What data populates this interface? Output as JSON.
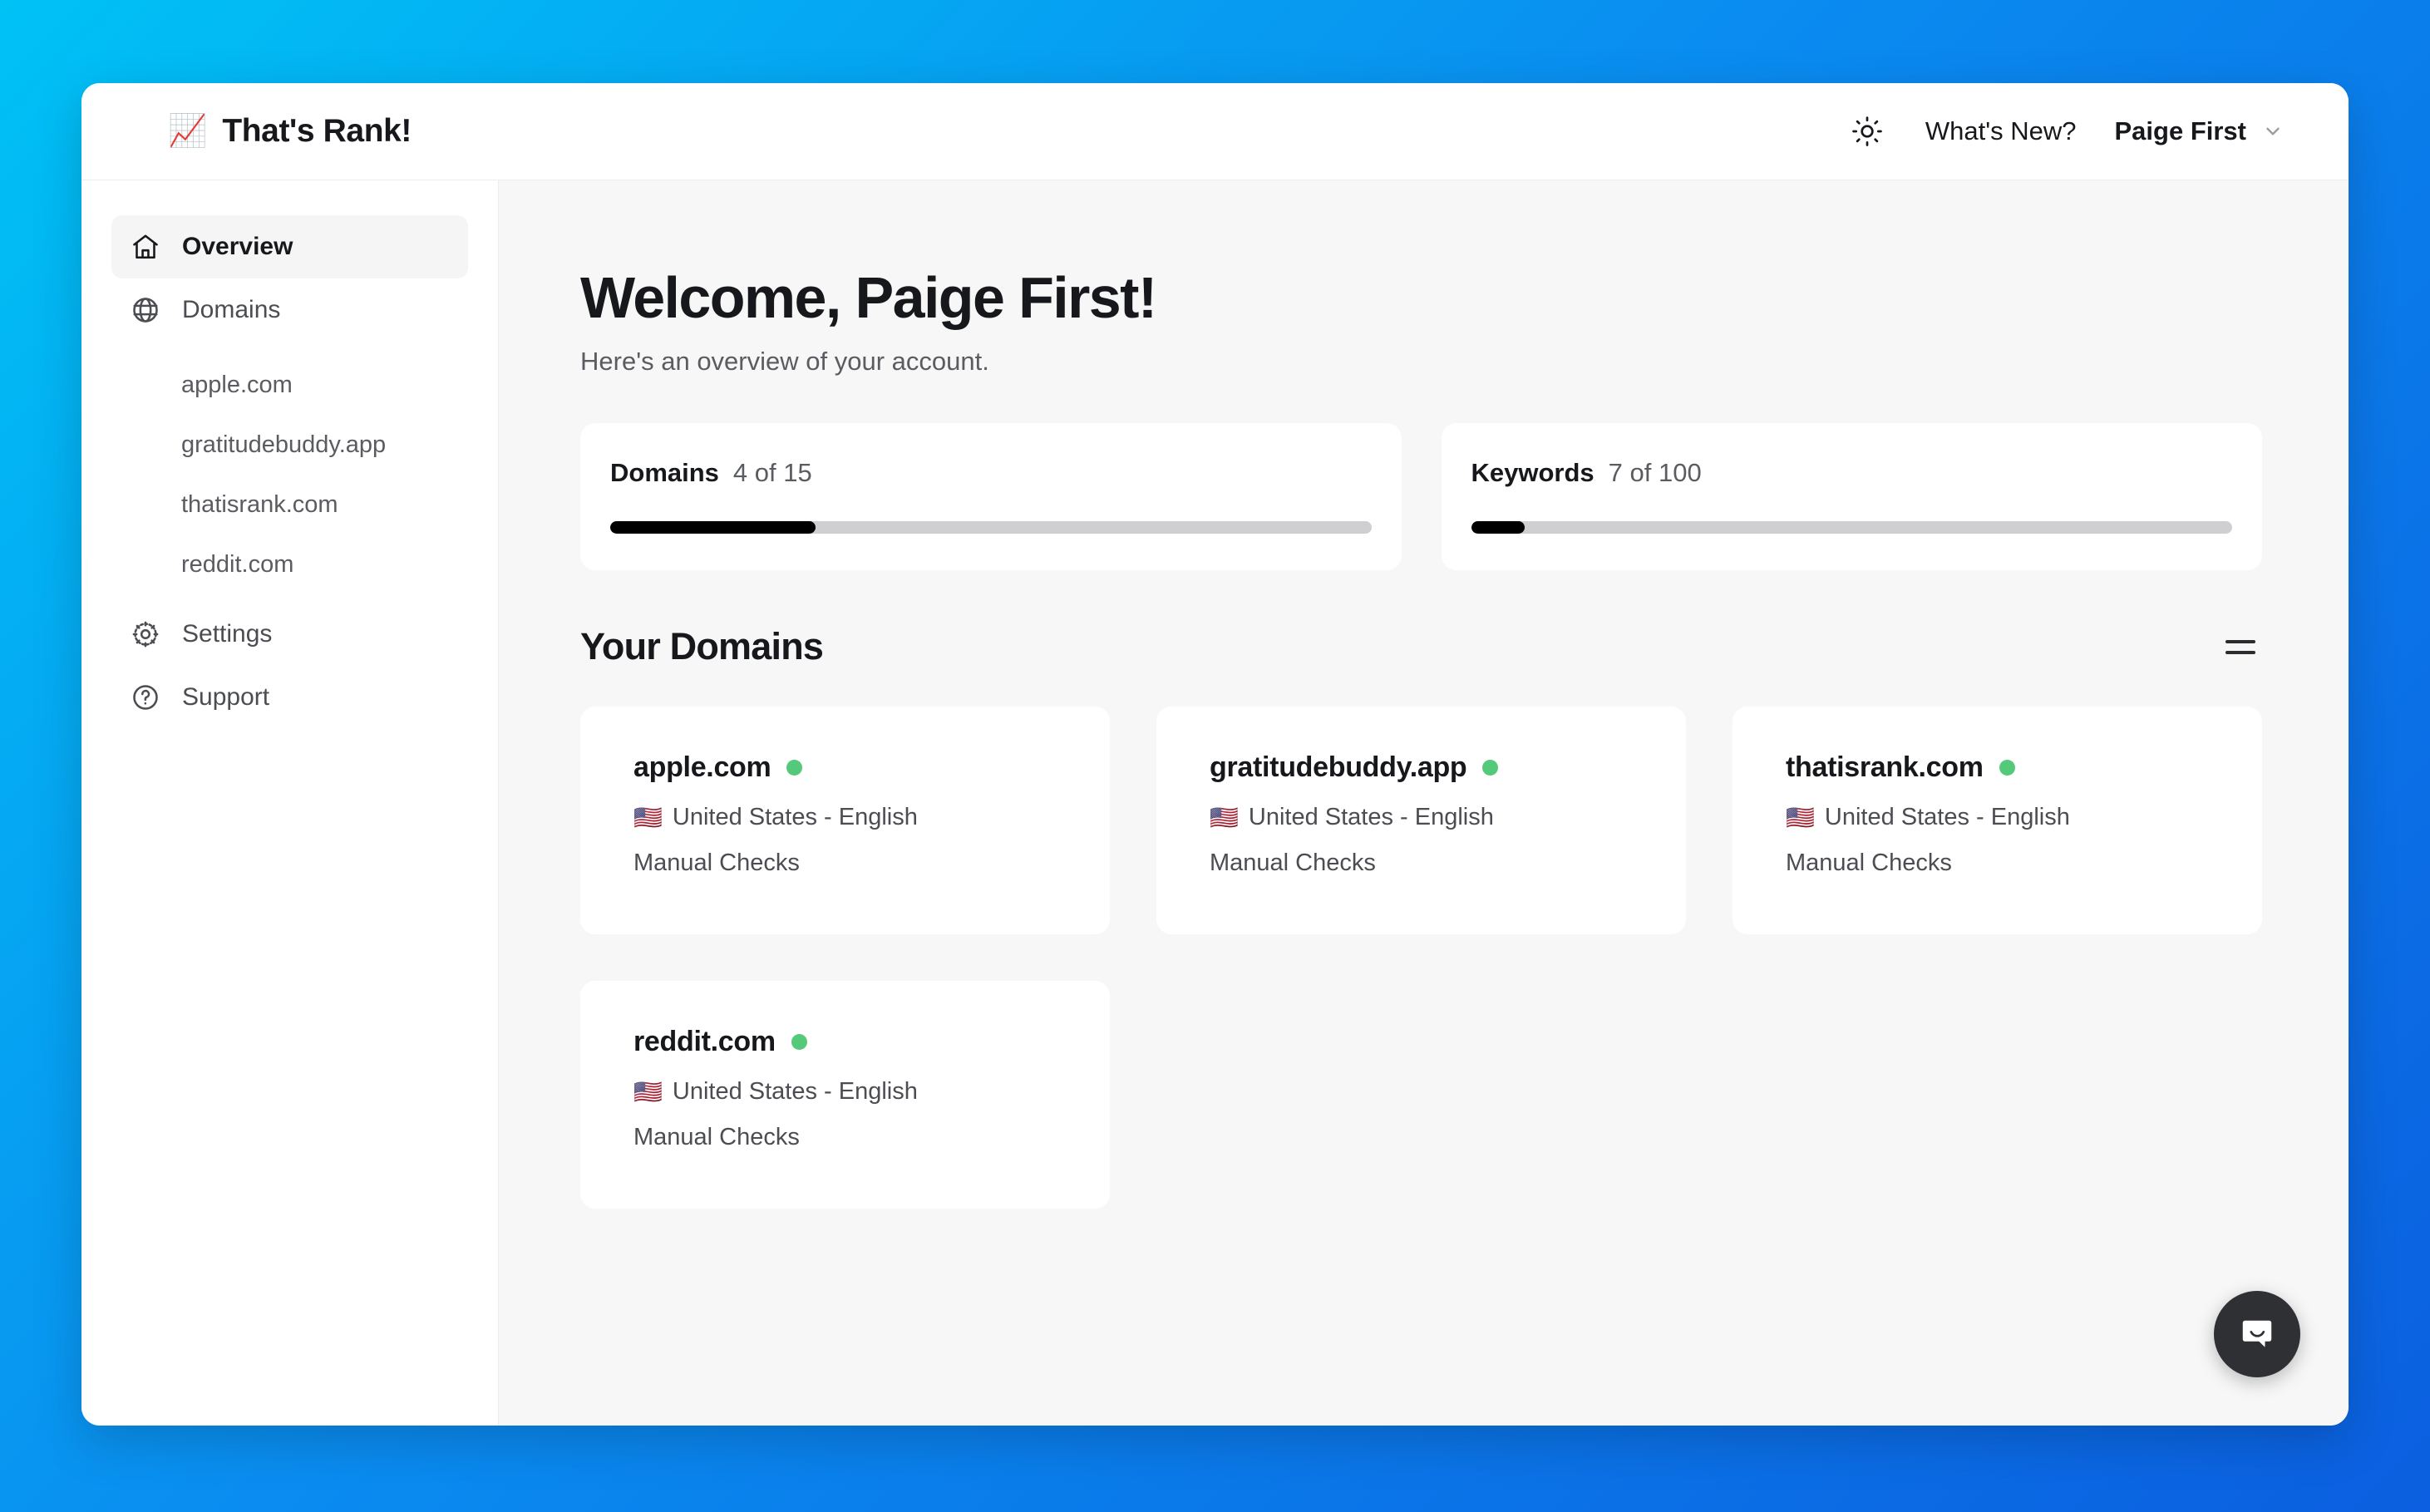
{
  "header": {
    "brand_emoji": "📈",
    "brand_name": "That's Rank!",
    "theme_toggle_icon": "sun-icon",
    "whats_new_label": "What's New?",
    "user_name": "Paige First",
    "user_chevron_icon": "chevron-down-icon"
  },
  "sidebar": {
    "items": [
      {
        "label": "Overview",
        "icon": "home-icon",
        "active": true
      },
      {
        "label": "Domains",
        "icon": "globe-icon",
        "active": false
      }
    ],
    "domain_links": [
      {
        "label": "apple.com"
      },
      {
        "label": "gratitudebuddy.app"
      },
      {
        "label": "thatisrank.com"
      },
      {
        "label": "reddit.com"
      }
    ],
    "bottom_items": [
      {
        "label": "Settings",
        "icon": "gear-icon"
      },
      {
        "label": "Support",
        "icon": "question-circle-icon"
      }
    ]
  },
  "main": {
    "title": "Welcome, Paige First!",
    "subtitle": "Here's an overview of your account.",
    "stats": [
      {
        "label": "Domains",
        "value": "4 of 15",
        "current": 4,
        "max": 15,
        "percent": 27
      },
      {
        "label": "Keywords",
        "value": "7 of 100",
        "current": 7,
        "max": 100,
        "percent": 7
      }
    ],
    "section": {
      "title": "Your Domains",
      "view_toggle_icon": "list-view-icon"
    },
    "domains": [
      {
        "name": "apple.com",
        "status": "online",
        "flag": "🇺🇸",
        "locale": "United States - English",
        "checks": "Manual Checks"
      },
      {
        "name": "gratitudebuddy.app",
        "status": "online",
        "flag": "🇺🇸",
        "locale": "United States - English",
        "checks": "Manual Checks"
      },
      {
        "name": "thatisrank.com",
        "status": "online",
        "flag": "🇺🇸",
        "locale": "United States - English",
        "checks": "Manual Checks"
      },
      {
        "name": "reddit.com",
        "status": "online",
        "flag": "🇺🇸",
        "locale": "United States - English",
        "checks": "Manual Checks"
      }
    ]
  },
  "chat": {
    "icon": "chat-bubble-smile-icon"
  },
  "colors": {
    "accent_green": "#55c97a",
    "progress_fill": "#000000",
    "progress_track": "#cfcfd2",
    "background_gradient_start": "#00c2f5",
    "background_gradient_end": "#0b5fe0",
    "chat_launcher": "#2f3033"
  }
}
